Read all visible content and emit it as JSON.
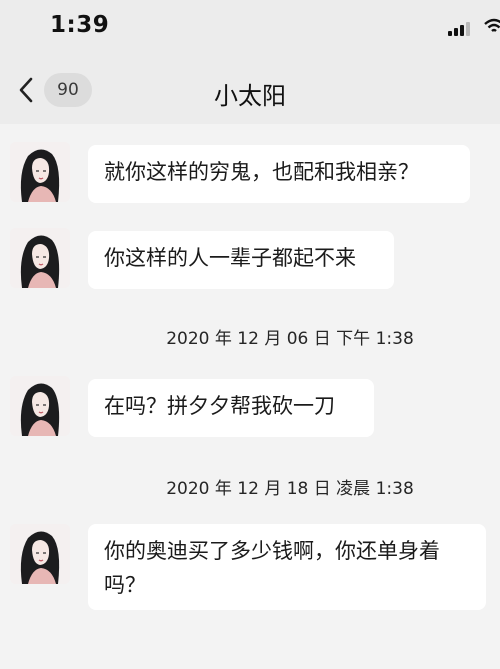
{
  "status_bar": {
    "time": "1:39"
  },
  "nav": {
    "back_badge": "90",
    "title": "小太阳"
  },
  "messages": [
    {
      "type": "incoming",
      "text": "就你这样的穷鬼，也配和我相亲？"
    },
    {
      "type": "incoming",
      "text": "你这样的人一辈子都起不来"
    },
    {
      "type": "timestamp",
      "text": "2020 年 12 月 06 日  下午 1:38"
    },
    {
      "type": "incoming",
      "text": "在吗？拼夕夕帮我砍一刀"
    },
    {
      "type": "timestamp",
      "text": "2020 年 12 月 18 日  凌晨 1:38"
    },
    {
      "type": "incoming",
      "text": "你的奥迪买了多少钱啊，你还单身着吗？"
    }
  ],
  "colors": {
    "background": "#f3f3f3",
    "bubble": "#ffffff",
    "badge": "#dcdcdc"
  },
  "icons": {
    "back": "chevron-left-icon",
    "signal": "signal-icon",
    "wifi": "wifi-icon",
    "avatar": "avatar-image"
  }
}
